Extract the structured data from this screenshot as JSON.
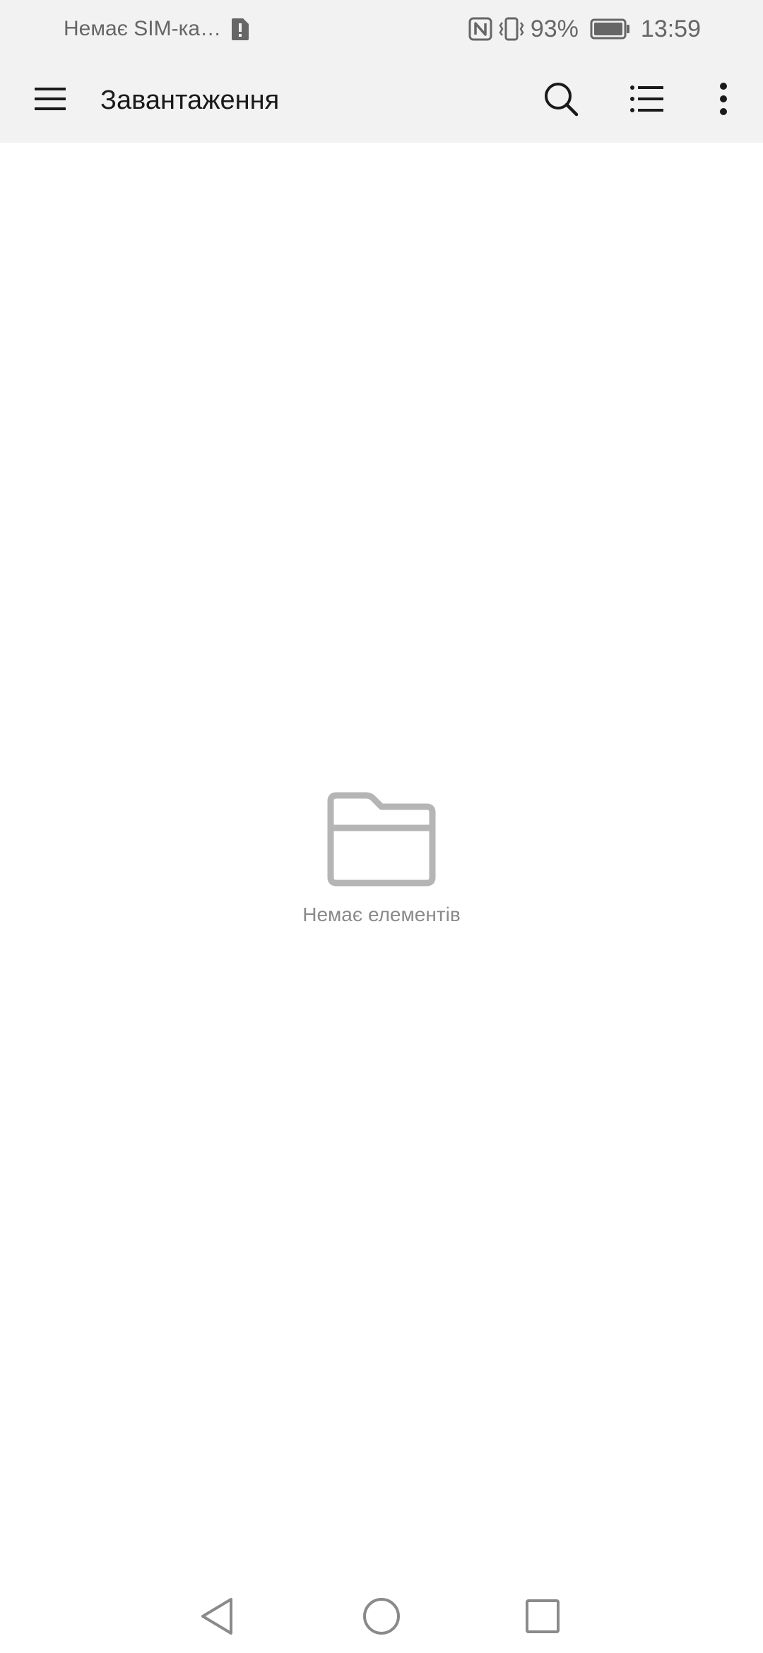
{
  "status_bar": {
    "sim_text": "Немає SIM-ка…",
    "battery_percent": "93%",
    "time": "13:59",
    "icons": [
      "sim-alert-icon",
      "nfc-icon",
      "vibrate-icon",
      "battery-icon"
    ]
  },
  "app_bar": {
    "title": "Завантаження",
    "icons": [
      "menu-icon",
      "search-icon",
      "list-view-icon",
      "more-vert-icon"
    ]
  },
  "empty_state": {
    "icon": "folder-icon",
    "text": "Немає елементів"
  },
  "nav_bar": {
    "icons": [
      "back-icon",
      "home-icon",
      "recents-icon"
    ]
  },
  "colors": {
    "bar_background": "#f2f2f2",
    "icon_dark": "#1a1a1a",
    "empty_gray": "#b5b5b5",
    "text_gray": "#8a8a8a"
  }
}
